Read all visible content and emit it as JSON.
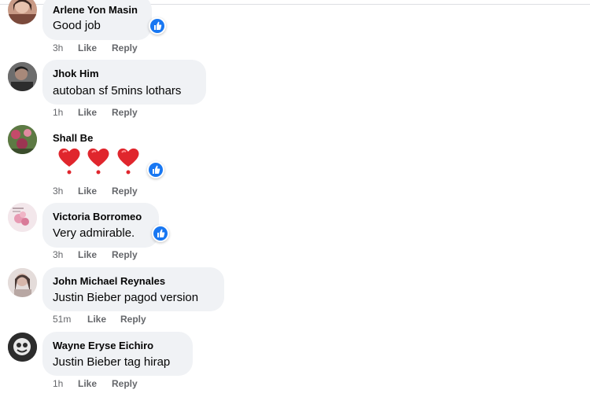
{
  "comments": [
    {
      "name": "Arlene Yon Masin",
      "text": "Good job",
      "time": "3h",
      "like": "Like",
      "reply": "Reply",
      "reaction_icon": "like-reaction-icon"
    },
    {
      "name": "Jhok Him",
      "text": "autoban sf 5mins lothars",
      "time": "1h",
      "like": "Like",
      "reply": "Reply"
    },
    {
      "name": "Shall Be",
      "text": "",
      "time": "3h",
      "like": "Like",
      "reply": "Reply",
      "emoji_icon": "red-heart-icon",
      "emoji_count": 3,
      "reaction_icon": "like-reaction-icon"
    },
    {
      "name": "Victoria Borromeo",
      "text": "Very admirable.",
      "time": "3h",
      "like": "Like",
      "reply": "Reply",
      "reaction_icon": "like-reaction-icon"
    },
    {
      "name": "John Michael Reynales",
      "text": "Justin Bieber pagod version",
      "time": "51m",
      "like": "Like",
      "reply": "Reply"
    },
    {
      "name": "Wayne Eryse Eichiro",
      "text": "Justin Bieber tag hirap",
      "time": "1h",
      "like": "Like",
      "reply": "Reply"
    }
  ],
  "colors": {
    "bubble": "#f0f2f5",
    "action_text": "#65676b",
    "like_blue": "#1877f2",
    "heart_red": "#e0262d"
  }
}
